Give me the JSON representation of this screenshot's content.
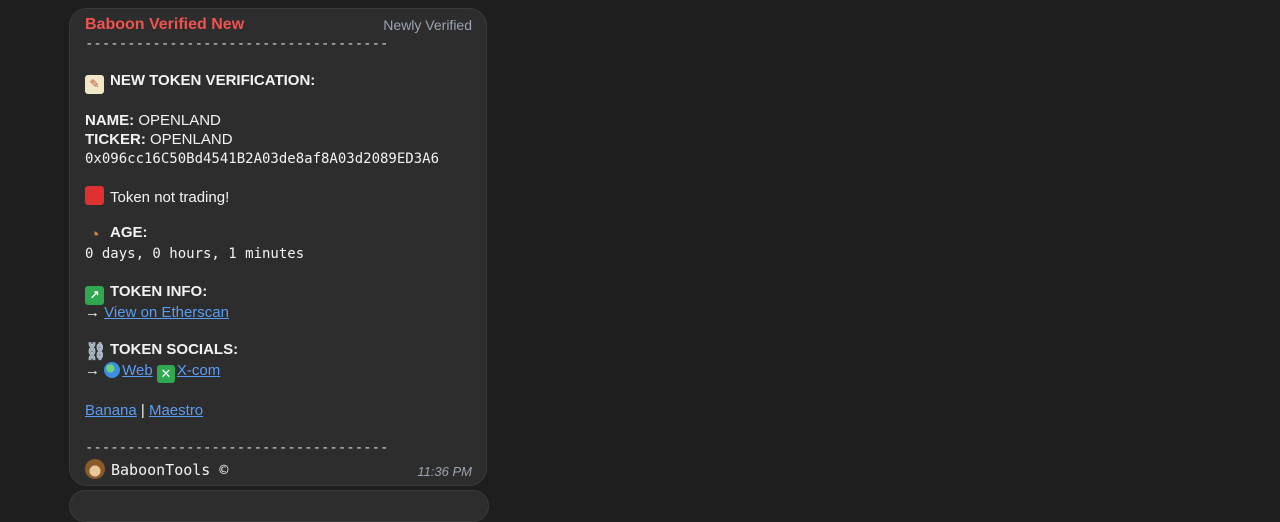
{
  "message": {
    "sender": "Baboon Verified New",
    "tag": "Newly Verified",
    "separator": "------------------------------------",
    "heading": "NEW TOKEN VERIFICATION:",
    "name_label": "NAME:",
    "name_value": "OPENLAND",
    "ticker_label": "TICKER:",
    "ticker_value": "OPENLAND",
    "contract_address": "0x096cc16C50Bd4541B2A03de8af8A03d2089ED3A6",
    "trading_status": "Token not trading!",
    "age_label": "AGE:",
    "age_value": "0 days, 0 hours, 1 minutes",
    "token_info_label": "TOKEN INFO:",
    "arrow": "→",
    "etherscan_link": "View on Etherscan",
    "token_socials_label": "TOKEN SOCIALS:",
    "web_link": "Web",
    "x_link": "X-com",
    "banana_link": "Banana",
    "divider_pipe": "|",
    "maestro_link": "Maestro",
    "footer_signature": "BaboonTools ©",
    "time": "11:36 PM"
  },
  "icons": {
    "heading": "memo-icon",
    "trading_status": "red-square-icon",
    "age": "mantelpiece-clock-icon",
    "token_info": "chart-icon",
    "token_socials": "link-icon",
    "web": "globe-icon",
    "x": "cross-mark-icon",
    "footer": "monkey-icon"
  },
  "colors": {
    "background": "#1e1e1e",
    "bubble": "#2d2d2d",
    "sender": "#f0524f",
    "link": "#5b9cf3",
    "meta": "#9aa4b2"
  }
}
